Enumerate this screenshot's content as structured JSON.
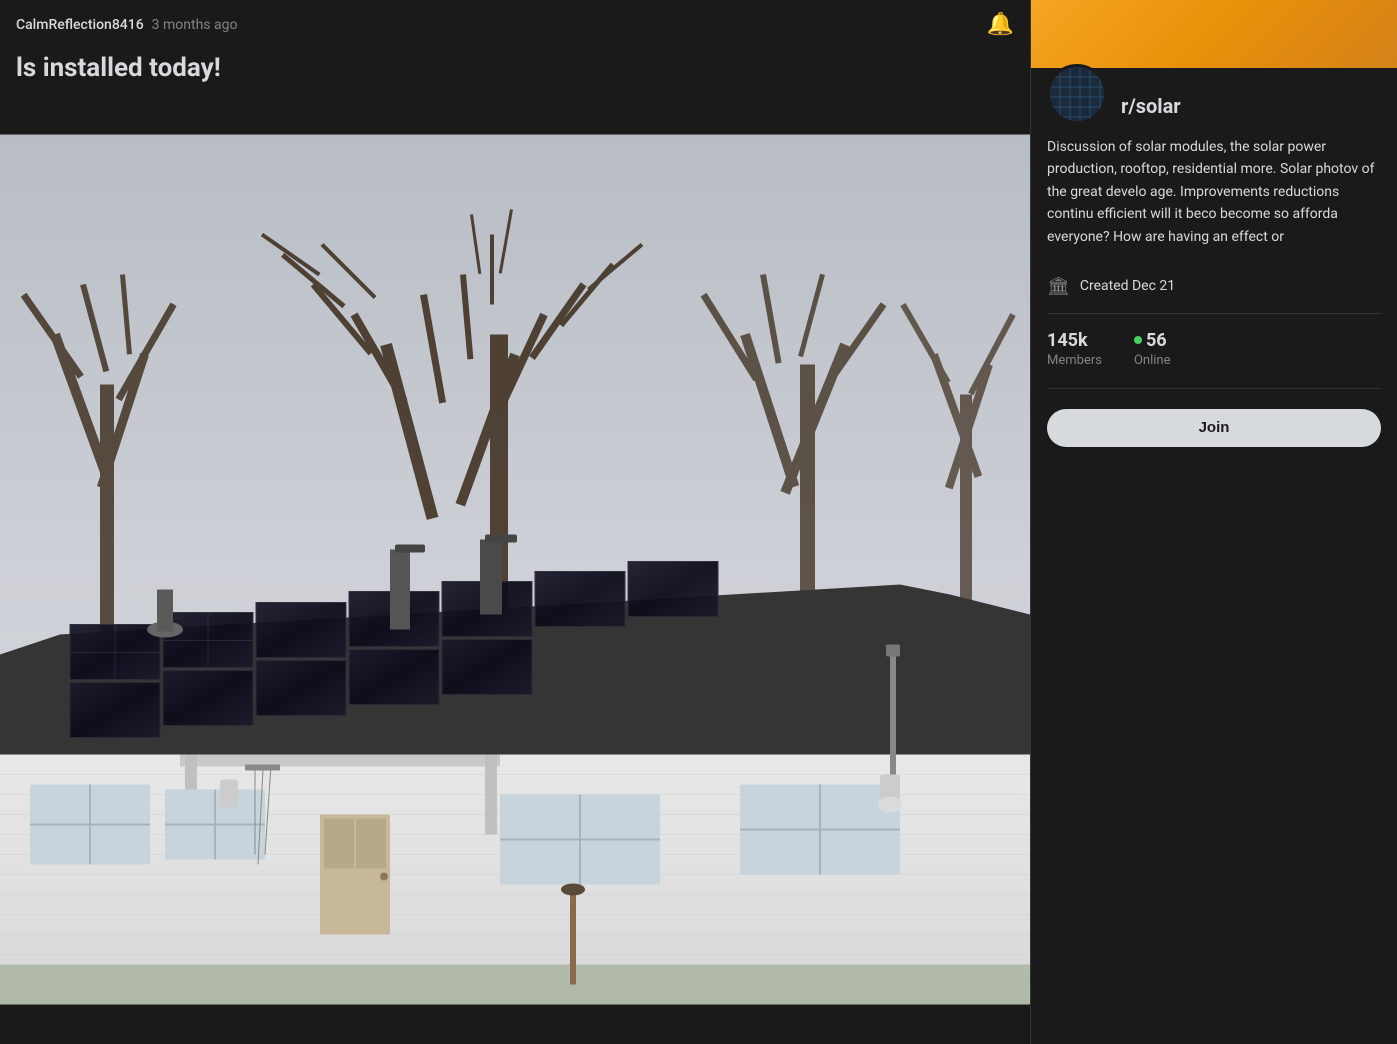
{
  "post": {
    "username": "CalmReflection8416",
    "time_ago": "3 months ago",
    "title": "ls installed today!",
    "image_alt": "Solar panels installed on rooftop of residential house"
  },
  "header": {
    "bell_label": "🔔"
  },
  "sidebar": {
    "subreddit_name": "r/solar",
    "description": "Discussion of solar modules, the solar power production, rooftop, residential more. Solar photov of the great develo age. Improvements reductions continu efficient will it beco become so afforda everyone? How are having an effect or",
    "created_label": "Created Dec 21",
    "members_count": "145k",
    "members_label": "Members",
    "online_count": "56",
    "online_label": "Online",
    "join_button_label": "Join"
  }
}
